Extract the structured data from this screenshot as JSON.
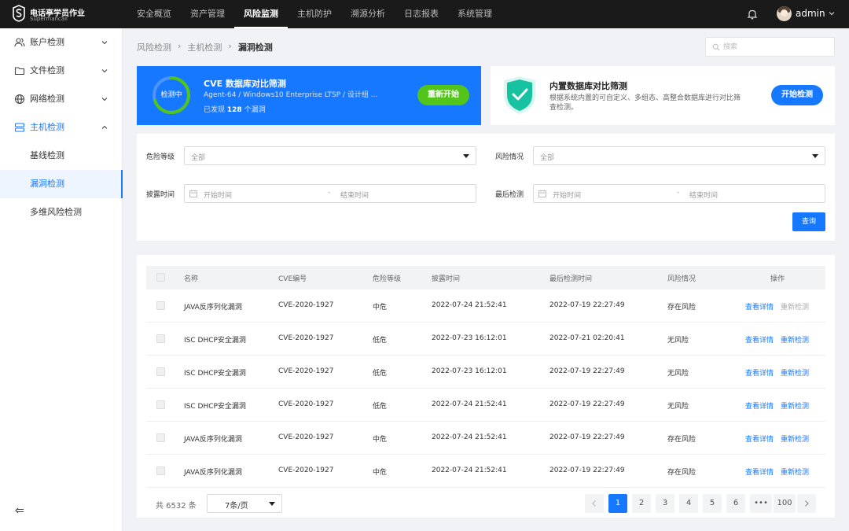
{
  "brand": {
    "title": "电话亭学员作业",
    "subtitle": "Supermancall"
  },
  "topnav": {
    "items": [
      "安全概览",
      "资产管理",
      "风险监测",
      "主机防护",
      "溯源分析",
      "日志报表",
      "系统管理"
    ],
    "active_index": 2
  },
  "user": {
    "name": "admin"
  },
  "sidebar": {
    "items": [
      {
        "label": "账户检测",
        "icon": "users-icon"
      },
      {
        "label": "文件检测",
        "icon": "folder-icon"
      },
      {
        "label": "网络检测",
        "icon": "globe-icon"
      },
      {
        "label": "主机检测",
        "icon": "server-icon"
      }
    ],
    "subitems": [
      "基线检测",
      "漏洞检测",
      "多维风险检测"
    ],
    "active_sub": 1
  },
  "breadcrumb": [
    "风险检测",
    "主机检测",
    "漏洞检测"
  ],
  "search": {
    "placeholder": "搜索"
  },
  "scan": {
    "status": "检测中",
    "title": "CVE 数据库对比筛测",
    "desc": "Agent-64 / Windows10 Enterprise LTSP / 设计组 ...",
    "found_prefix": "已发现",
    "found_count": "128",
    "found_suffix": "个漏洞",
    "button": "重新开始",
    "progress": 0.7
  },
  "db": {
    "title": "内置数据库对比筛测",
    "desc": "根据系统内置的可自定义、多组态、高整合数据库进行对比筛查检测。",
    "button": "开始检测"
  },
  "filters": {
    "risk_level": {
      "label": "危险等级",
      "value": "全部"
    },
    "risk_status": {
      "label": "风险情况",
      "value": "全部"
    },
    "disclosed": {
      "label": "披露时间",
      "start": "开始时间",
      "sep": "-",
      "end": "结束时间"
    },
    "last_check": {
      "label": "最后检测",
      "start": "开始时间",
      "sep": "-",
      "end": "结束时间"
    },
    "query": "查询"
  },
  "table": {
    "headers": [
      "名称",
      "CVE编号",
      "危险等级",
      "披露时间",
      "最后检测时间",
      "风险情况",
      "操作"
    ],
    "rows": [
      {
        "name": "JAVA反序列化漏洞",
        "cve": "CVE-2020-1927",
        "level": "中危",
        "disclosed": "2022-07-24 21:52:41",
        "last": "2022-07-19 22:27:49",
        "risk": "存在风险",
        "view": "查看详情",
        "recheck": "重新检测",
        "recheck_disabled": true
      },
      {
        "name": "ISC DHCP安全漏洞",
        "cve": "CVE-2020-1927",
        "level": "低危",
        "disclosed": "2022-07-23 16:12:01",
        "last": "2022-07-21 02:20:41",
        "risk": "无风险",
        "view": "查看详情",
        "recheck": "重新检测",
        "recheck_disabled": false
      },
      {
        "name": "ISC DHCP安全漏洞",
        "cve": "CVE-2020-1927",
        "level": "低危",
        "disclosed": "2022-07-23 16:12:01",
        "last": "2022-07-19 22:27:49",
        "risk": "无风险",
        "view": "查看详情",
        "recheck": "重新检测",
        "recheck_disabled": false
      },
      {
        "name": "ISC DHCP安全漏洞",
        "cve": "CVE-2020-1927",
        "level": "低危",
        "disclosed": "2022-07-24 21:52:41",
        "last": "2022-07-19 22:27:49",
        "risk": "无风险",
        "view": "查看详情",
        "recheck": "重新检测",
        "recheck_disabled": false
      },
      {
        "name": "JAVA反序列化漏洞",
        "cve": "CVE-2020-1927",
        "level": "中危",
        "disclosed": "2022-07-24 21:52:41",
        "last": "2022-07-19 22:27:49",
        "risk": "存在风险",
        "view": "查看详情",
        "recheck": "重新检测",
        "recheck_disabled": false
      },
      {
        "name": "JAVA反序列化漏洞",
        "cve": "CVE-2020-1927",
        "level": "中危",
        "disclosed": "2022-07-24 21:52:41",
        "last": "2022-07-19 22:27:49",
        "risk": "存在风险",
        "view": "查看详情",
        "recheck": "重新检测",
        "recheck_disabled": false
      }
    ]
  },
  "pagination": {
    "total": "共 6532 条",
    "page_size": "7条/页",
    "pages": [
      "1",
      "2",
      "3",
      "4",
      "5",
      "6",
      "•••",
      "100"
    ],
    "current": "1"
  },
  "colors": {
    "accent": "#1677ff",
    "success": "#52c41a",
    "topbar": "#1a1a1a"
  }
}
